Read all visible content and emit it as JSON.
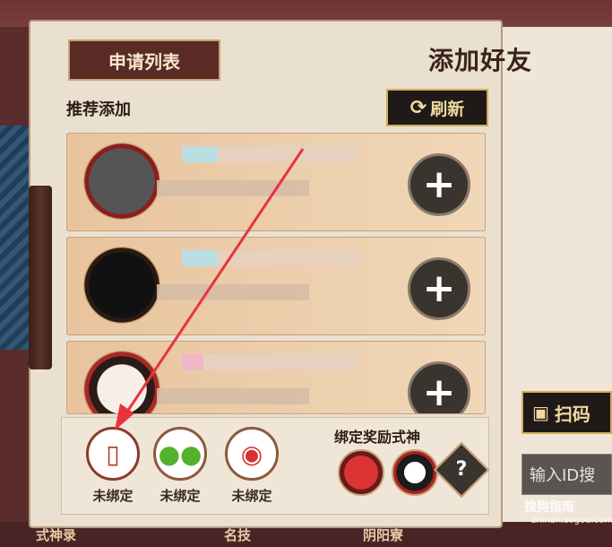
{
  "tabs": {
    "apply_list": "申请列表"
  },
  "title": "添加好友",
  "section": "推荐添加",
  "refresh_label": "刷新",
  "cards": [
    {
      "action": "+"
    },
    {
      "action": "+"
    },
    {
      "action": "+"
    }
  ],
  "bind": {
    "heading": "绑定奖励式神",
    "items": [
      {
        "label": "未绑定",
        "icon": "phone-icon"
      },
      {
        "label": "未绑定",
        "icon": "wechat-icon"
      },
      {
        "label": "未绑定",
        "icon": "weibo-icon"
      }
    ],
    "help": "?"
  },
  "scan_label": "扫码",
  "id_search_placeholder": "输入ID搜",
  "bottom_nav": [
    "式神录",
    "名技",
    "阴阳寮"
  ],
  "watermark": {
    "main": "搜狗指南",
    "sub": "zhinan.sogou.com"
  },
  "colors": {
    "accent": "#d4aa5c",
    "arrow": "#e8343c",
    "panel": "#eae0d0"
  }
}
